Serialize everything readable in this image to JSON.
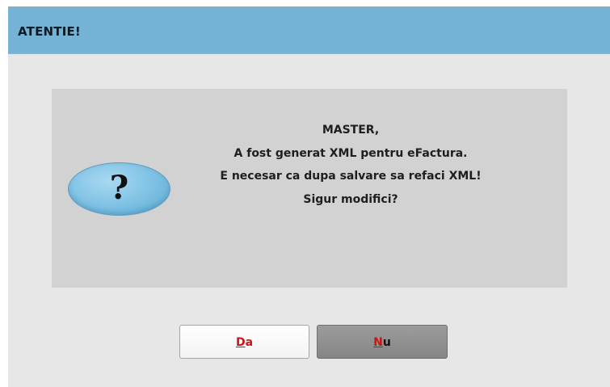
{
  "dialog": {
    "title": "ATENTIE!"
  },
  "message": {
    "icon": "question-icon",
    "icon_glyph": "?",
    "lines": [
      "MASTER,",
      "A fost generat XML pentru eFactura.",
      "E necesar ca dupa salvare sa refaci XML!",
      "Sigur modifici?"
    ]
  },
  "buttons": {
    "yes": {
      "mnemonic": "D",
      "rest": "a",
      "state": "focused"
    },
    "no": {
      "mnemonic": "N",
      "rest": "u",
      "state": "pressed"
    }
  },
  "colors": {
    "titlebar": "#74b3d3",
    "panel": "#d2d2d2",
    "background": "#e7e7e7",
    "mnemonic": "#cc1414"
  }
}
